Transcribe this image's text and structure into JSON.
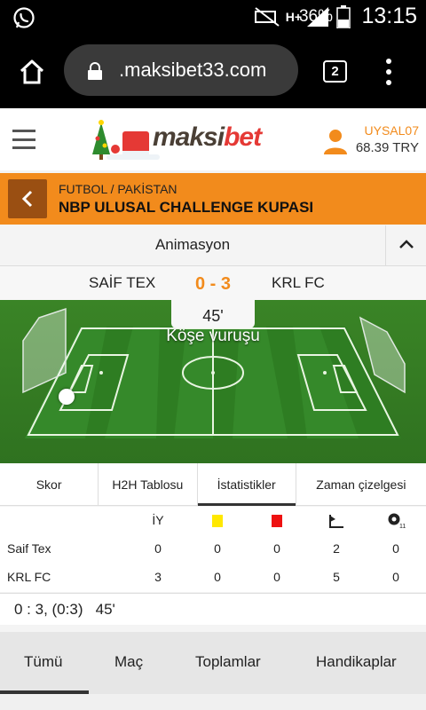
{
  "statusbar": {
    "battery": "36%",
    "time": "13:15",
    "network": "H+"
  },
  "browser": {
    "url": ".maksibet33.com",
    "tab_count": "2"
  },
  "header": {
    "logo_left": "maksi",
    "logo_right": "bet",
    "username": "UYSAL07",
    "balance": "68.39 TRY"
  },
  "event": {
    "sport_path": "FUTBOL / PAKİSTAN",
    "league": "NBP ULUSAL CHALLENGE KUPASI"
  },
  "animation": {
    "title": "Animasyon"
  },
  "match": {
    "home": "SAİF TEX",
    "away": "KRL FC",
    "score": "0 - 3",
    "minute": "45'",
    "event_text": "Köşe vuruşu"
  },
  "stat_tabs": [
    "Skor",
    "H2H Tablosu",
    "İstatistikler",
    "Zaman çizelgesi"
  ],
  "stats": {
    "header_ht": "İY",
    "rows": [
      {
        "team": "Saif Tex",
        "values": [
          "0",
          "0",
          "0",
          "2",
          "0"
        ]
      },
      {
        "team": "KRL FC",
        "values": [
          "3",
          "0",
          "0",
          "5",
          "0"
        ]
      }
    ],
    "status_line": "0 : 3, (0:3)   45'"
  },
  "market_tabs": [
    "Tümü",
    "Maç",
    "Toplamlar",
    "Handikaplar"
  ],
  "colors": {
    "accent": "#f28b1c",
    "back_button": "#9a4f12",
    "pitch": "#3f8a2a"
  }
}
